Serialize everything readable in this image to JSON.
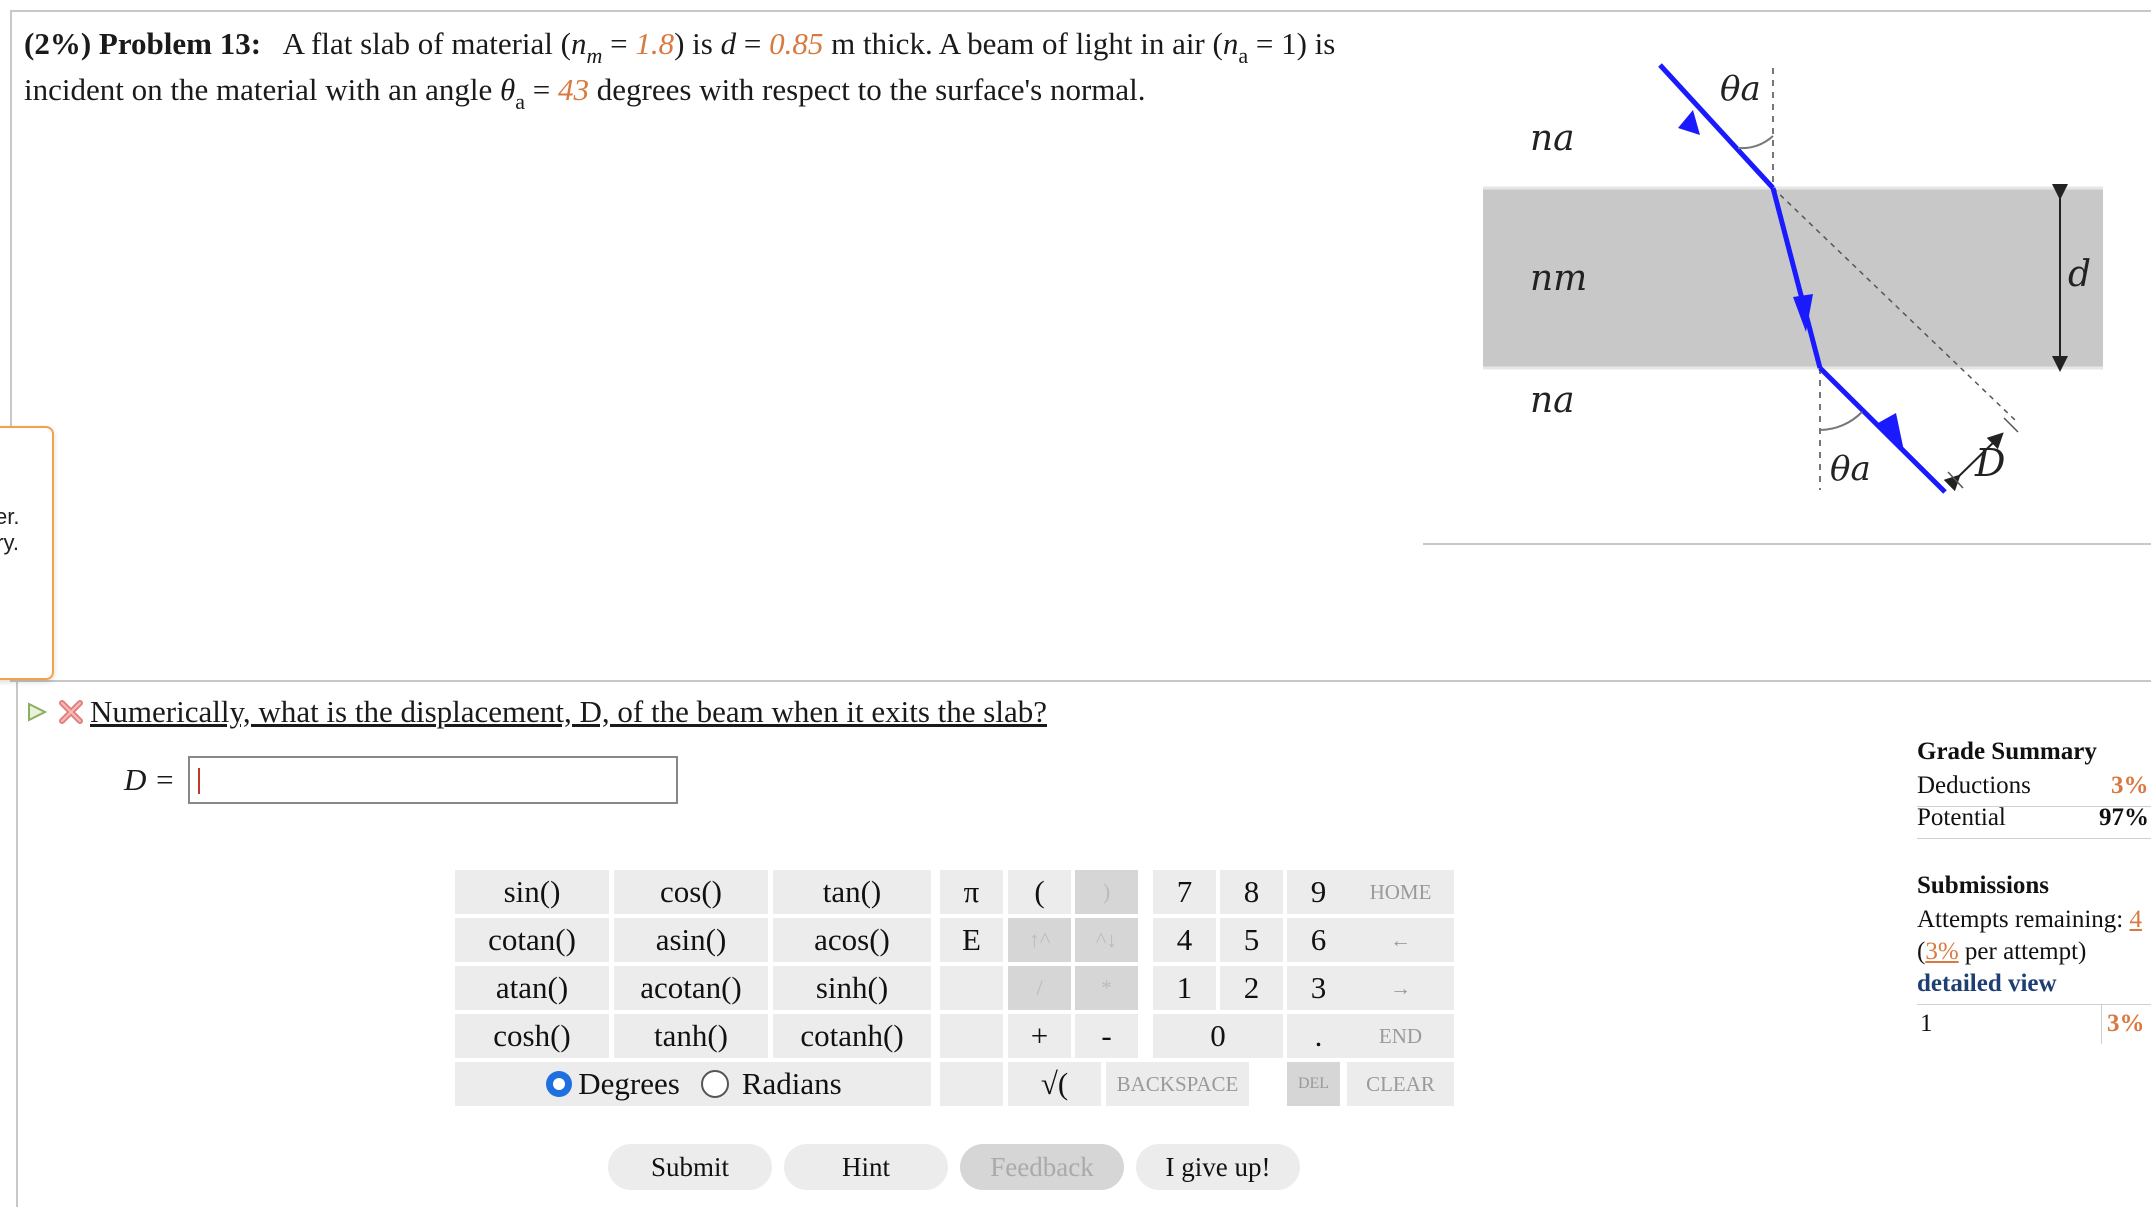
{
  "problem": {
    "percent": "(2%)",
    "label": "Problem 13:",
    "t1": "A flat slab of material (",
    "nm": "n",
    "nm_sub": "m",
    "eq1": " = ",
    "nm_val": "1.8",
    "t2": ") is ",
    "d_sym": "d",
    "eq2": " = ",
    "d_val": "0.85",
    "t3": " m thick. A beam of light in air (",
    "na": "n",
    "na_sub": "a",
    "t4": " = 1) is",
    "line2a": "incident on the material with an angle ",
    "theta": "θ",
    "theta_sub": "a",
    "eq3": " = ",
    "theta_val": "43",
    "line2b": " degrees with respect to the surface's normal."
  },
  "figure": {
    "label_na_top": "na",
    "label_nm": "nm",
    "label_na_bottom": "na",
    "theta_top": "θa",
    "theta_bottom": "θa",
    "d_label": "d",
    "D_label": "D"
  },
  "tooltip": {
    "line1": "ver.",
    "line2": "ory."
  },
  "question": {
    "text": "Numerically, what is the displacement, D, of the beam when it exits the slab?",
    "answer_label": "D =",
    "answer_value": ""
  },
  "keypad": {
    "functions": [
      [
        "sin()",
        "cos()",
        "tan()"
      ],
      [
        "cotan()",
        "asin()",
        "acos()"
      ],
      [
        "atan()",
        "acotan()",
        "sinh()"
      ],
      [
        "cosh()",
        "tanh()",
        "cotanh()"
      ]
    ],
    "pi": "π",
    "e": "E",
    "open_paren": "(",
    "close_paren": ")",
    "up_arrow": "↑^",
    "down_arrow": "^↓",
    "divide": "/",
    "multiply": "*",
    "plus": "+",
    "minus": "-",
    "sqrt": "√(",
    "digits": [
      "7",
      "8",
      "9",
      "4",
      "5",
      "6",
      "1",
      "2",
      "3",
      "0",
      "."
    ],
    "home": "HOME",
    "left": "←",
    "right": "→",
    "end": "END",
    "backspace": "BACKSPACE",
    "del": "DEL",
    "clear": "CLEAR",
    "degrees": "Degrees",
    "radians": "Radians",
    "mode_selected": "Degrees"
  },
  "buttons": {
    "submit": "Submit",
    "hint": "Hint",
    "feedback": "Feedback",
    "give_up": "I give up!"
  },
  "grade_summary": {
    "title": "Grade Summary",
    "deductions_label": "Deductions",
    "deductions_value": "3%",
    "potential_label": "Potential",
    "potential_value": "97%"
  },
  "submissions": {
    "title": "Submissions",
    "attempts_label": "Attempts remaining: ",
    "attempts_value": "4",
    "per_attempt_open": "(",
    "per_attempt_value": "3%",
    "per_attempt_text": " per attempt)",
    "detailed_view": "detailed view",
    "row_index": "1",
    "row_value": "3%"
  },
  "colors": {
    "highlight": "#d9783f",
    "beam": "#1a1aff",
    "slab": "#c8c8c8",
    "link": "#1f3f73"
  }
}
